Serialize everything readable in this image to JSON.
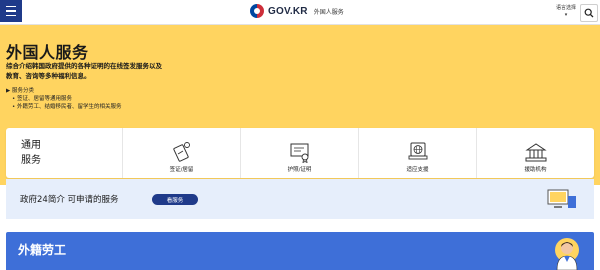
{
  "header": {
    "menu_icon": "hamburger-icon",
    "logo_text": "GOV.KR",
    "logo_sub": "外国人服务",
    "lang_line1": "语言选择",
    "lang_line2": "▾",
    "search_icon": "search-icon"
  },
  "hero": {
    "title": "外国人服务",
    "desc_line1": "综合介绍韩国政府提供的各种证明的在线签发服务以及",
    "desc_line2": "教育、咨询等多种福利信息。",
    "category_title": "▶ 服务分类",
    "category_items": [
      "• 签证、居留等通用服务",
      "• 外籍劳工、结婚移民者、留学生的相关服务"
    ]
  },
  "services": {
    "heading_line1": "通用",
    "heading_line2": "服务",
    "items": [
      {
        "label": "签证/居留",
        "icon": "visa-icon"
      },
      {
        "label": "护照/证明",
        "icon": "certificate-icon"
      },
      {
        "label": "适应支援",
        "icon": "globe-icon"
      },
      {
        "label": "援助机构",
        "icon": "institution-icon"
      }
    ]
  },
  "gov24": {
    "text": "政府24简介 可申请的服务",
    "button": "看服务",
    "icon": "monitor-icon"
  },
  "section": {
    "title": "外籍劳工",
    "avatar_icon": "worker-avatar-icon"
  },
  "colors": {
    "hero_bg": "#ffd460",
    "brand_blue": "#1f3a8a",
    "section_blue": "#3e6fd8",
    "gov24_bg": "#e6eefb"
  }
}
